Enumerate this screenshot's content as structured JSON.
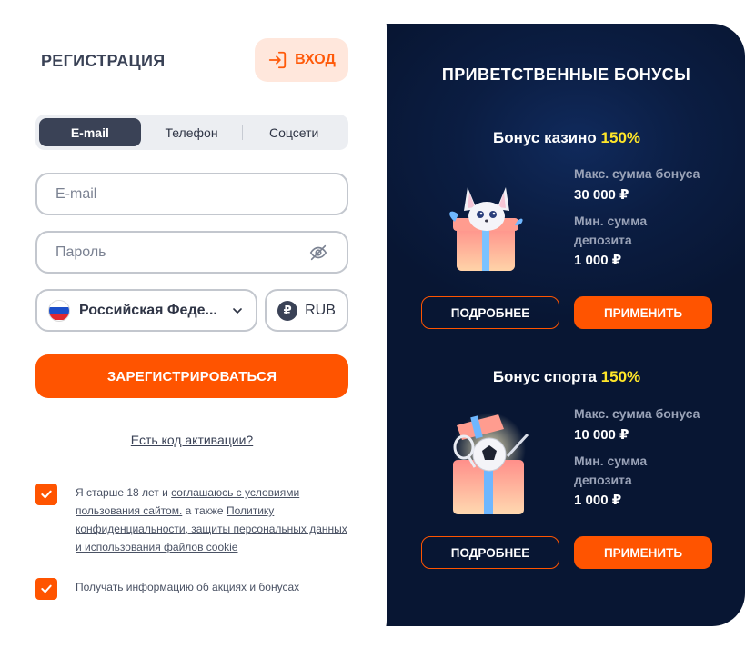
{
  "registration": {
    "title": "РЕГИСТРАЦИЯ",
    "login_label": "ВХОД",
    "tabs": [
      {
        "label": "E-mail",
        "active": true
      },
      {
        "label": "Телефон",
        "active": false
      },
      {
        "label": "Соцсети",
        "active": false
      }
    ],
    "email_placeholder": "E-mail",
    "password_placeholder": "Пароль",
    "country": "Российская Феде...",
    "currency": "RUB",
    "currency_symbol": "₽",
    "register_label": "ЗАРЕГИСТРИРОВАТЬСЯ",
    "activation_link": "Есть код активации?",
    "consent": {
      "prefix": "Я старше 18 лет и ",
      "link1": "соглашаюсь с условиями пользования сайтом.",
      "middle": " а также ",
      "link2": "Политику конфиденциальности, защиты персональных данных и использования файлов cookie",
      "checked": true
    },
    "promo_consent": {
      "label": "Получать информацию об акциях и бонусах",
      "checked": true
    },
    "accent_color": "#ff5400"
  },
  "bonuses": {
    "title": "ПРИВЕТСТВЕННЫЕ БОНУСЫ",
    "items": [
      {
        "name": "Бонус казино",
        "percent": "150%",
        "max_label": "Макс. сумма бонуса",
        "max_value": "30 000 ₽",
        "min_label": "Мин. сумма депозита",
        "min_value": "1 000 ₽",
        "more_label": "ПОДРОБНЕЕ",
        "apply_label": "ПРИМЕНИТЬ",
        "art": "fox-gift-box"
      },
      {
        "name": "Бонус спорта",
        "percent": "150%",
        "max_label": "Макс. сумма бонуса",
        "max_value": "10 000 ₽",
        "min_label": "Мин. сумма депозита",
        "min_value": "1 000 ₽",
        "more_label": "ПОДРОБНЕЕ",
        "apply_label": "ПРИМЕНИТЬ",
        "art": "sport-gift-box"
      }
    ],
    "panel_color": "#0b1d42",
    "highlight_color": "#ffe629"
  }
}
